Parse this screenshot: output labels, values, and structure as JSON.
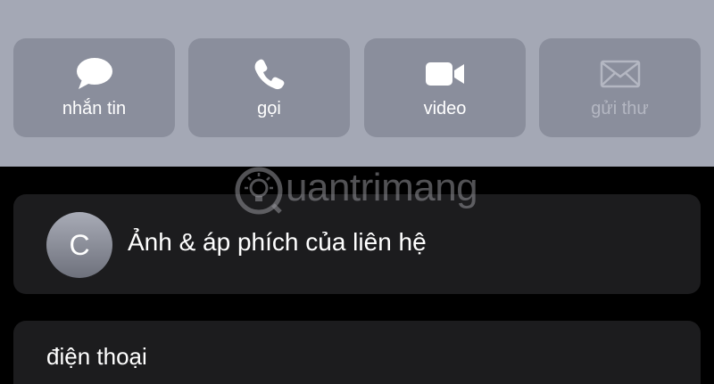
{
  "actions": {
    "message": {
      "label": "nhắn tin",
      "icon": "message-bubble-icon"
    },
    "call": {
      "label": "gọi",
      "icon": "phone-icon"
    },
    "video": {
      "label": "video",
      "icon": "video-camera-icon"
    },
    "mail": {
      "label": "gửi thư",
      "icon": "envelope-icon",
      "enabled": false
    }
  },
  "contact_photo": {
    "avatar_initial": "C",
    "label": "Ảnh & áp phích của liên hệ"
  },
  "phone_section": {
    "label": "điện thoại"
  },
  "watermark": {
    "text": "uantrimang",
    "icon": "lightbulb-logo-icon"
  },
  "colors": {
    "action_bar_bg": "#a4a8b5",
    "action_button_bg": "#8a8e9c",
    "card_bg": "#1c1c1e",
    "page_bg": "#000000"
  }
}
